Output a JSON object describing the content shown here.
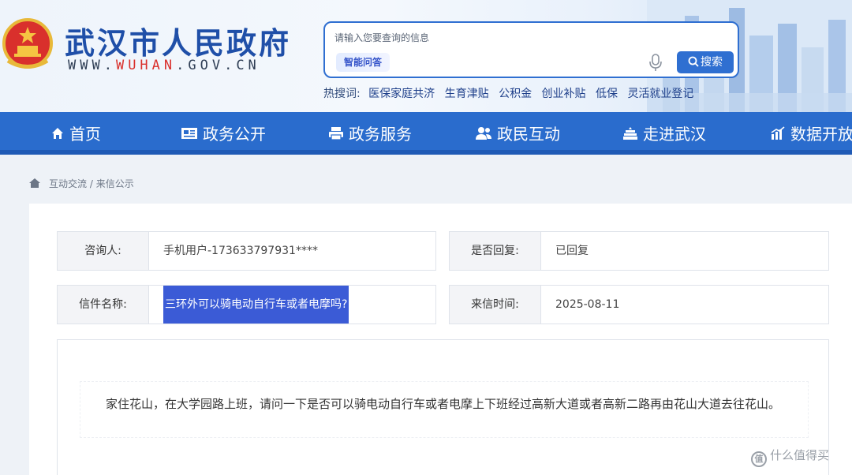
{
  "header": {
    "site_title": "武汉市人民政府",
    "site_url_prefix": "WWW.",
    "site_url_highlight": "WUHAN",
    "site_url_suffix": ".GOV.CN",
    "search": {
      "placeholder": "请输入您要查询的信息",
      "ai_button": "智能问答",
      "search_button": "搜索"
    },
    "hot_search": {
      "label": "热搜词:",
      "items": [
        "医保家庭共济",
        "生育津贴",
        "公积金",
        "创业补贴",
        "低保",
        "灵活就业登记"
      ]
    }
  },
  "nav": {
    "items": [
      {
        "label": "首页",
        "icon": "home-icon"
      },
      {
        "label": "政务公开",
        "icon": "newspaper-icon"
      },
      {
        "label": "政务服务",
        "icon": "printer-icon"
      },
      {
        "label": "政民互动",
        "icon": "users-icon"
      },
      {
        "label": "走进武汉",
        "icon": "building-icon"
      },
      {
        "label": "数据开放",
        "icon": "chart-icon"
      }
    ]
  },
  "breadcrumb": {
    "items": [
      "互动交流",
      "来信公示"
    ],
    "separator": "/"
  },
  "letter": {
    "asker_label": "咨询人:",
    "asker_value": "手机用户-173633797931****",
    "reply_label": "是否回复:",
    "reply_value": "已回复",
    "title_label": "信件名称:",
    "title_value": "三环外可以骑电动自行车或者电摩吗?",
    "time_label": "来信时间:",
    "time_value": "2025-08-11",
    "body": "家住花山，在大学园路上班，请问一下是否可以骑电动自行车或者电摩上下班经过高新大道或者高新二路再由花山大道去往花山。"
  },
  "watermark": {
    "icon_text": "值",
    "text": "什么值得买"
  },
  "colors": {
    "brand_blue": "#2a6ccd",
    "title_blue": "#1f4fa8",
    "selection_blue": "#3b5bd6",
    "url_red": "#d9302c"
  }
}
